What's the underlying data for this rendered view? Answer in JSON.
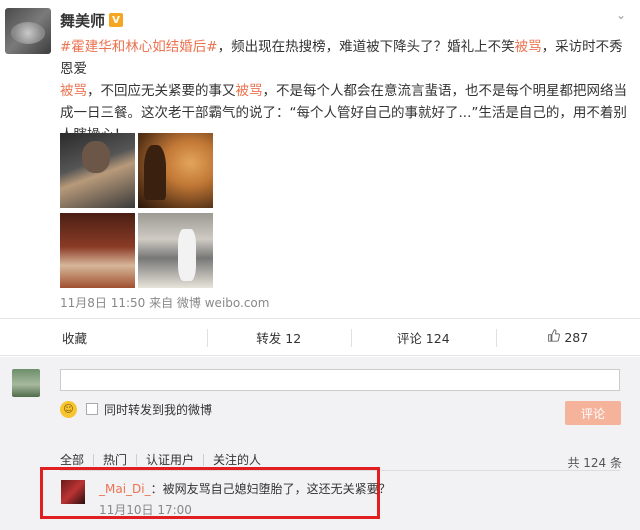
{
  "post": {
    "username": "舞美师",
    "vip_badge": "V",
    "more_glyph": "⌄",
    "text_parts": {
      "hashtag": "#霍建华和林心如结婚后#",
      "p1": "，频出现在热搜榜，难道被下降头了？婚礼上不笑",
      "h1": "被骂",
      "p2": "，采访时不秀恩爱",
      "h2": "被骂",
      "p3": "，不回应无关紧要的事又",
      "h3": "被骂",
      "p4": "，不是每个人都会在意流言蜚语，也不是每个明星都把网络当成一日三餐。这次老干部霸气的说了：“每个人管好自己的事就好了...”生活是自己的，用不着别人瞎操心！"
    },
    "meta": "11月8日 11:50 来自 微博 weibo.com"
  },
  "actions": {
    "favorite": "收藏",
    "repost": "转发 12",
    "comment": "评论 124",
    "like_icon": "thumbs-up-icon",
    "like": "287"
  },
  "comment_form": {
    "repost_label": "同时转发到我的微博",
    "submit": "评论"
  },
  "filters": {
    "all": "全部",
    "hot": "热门",
    "verified": "认证用户",
    "following": "关注的人",
    "count": "共 124 条"
  },
  "comment": {
    "user": "_Mai_Di_",
    "text": "：被网友骂自己媳妇堕胎了，这还无关紧要？",
    "time": "11月10日 17:00"
  },
  "colors": {
    "highlight": "#eb7350",
    "annotation_box": "#e02020",
    "submit_button": "#f6b39c"
  }
}
